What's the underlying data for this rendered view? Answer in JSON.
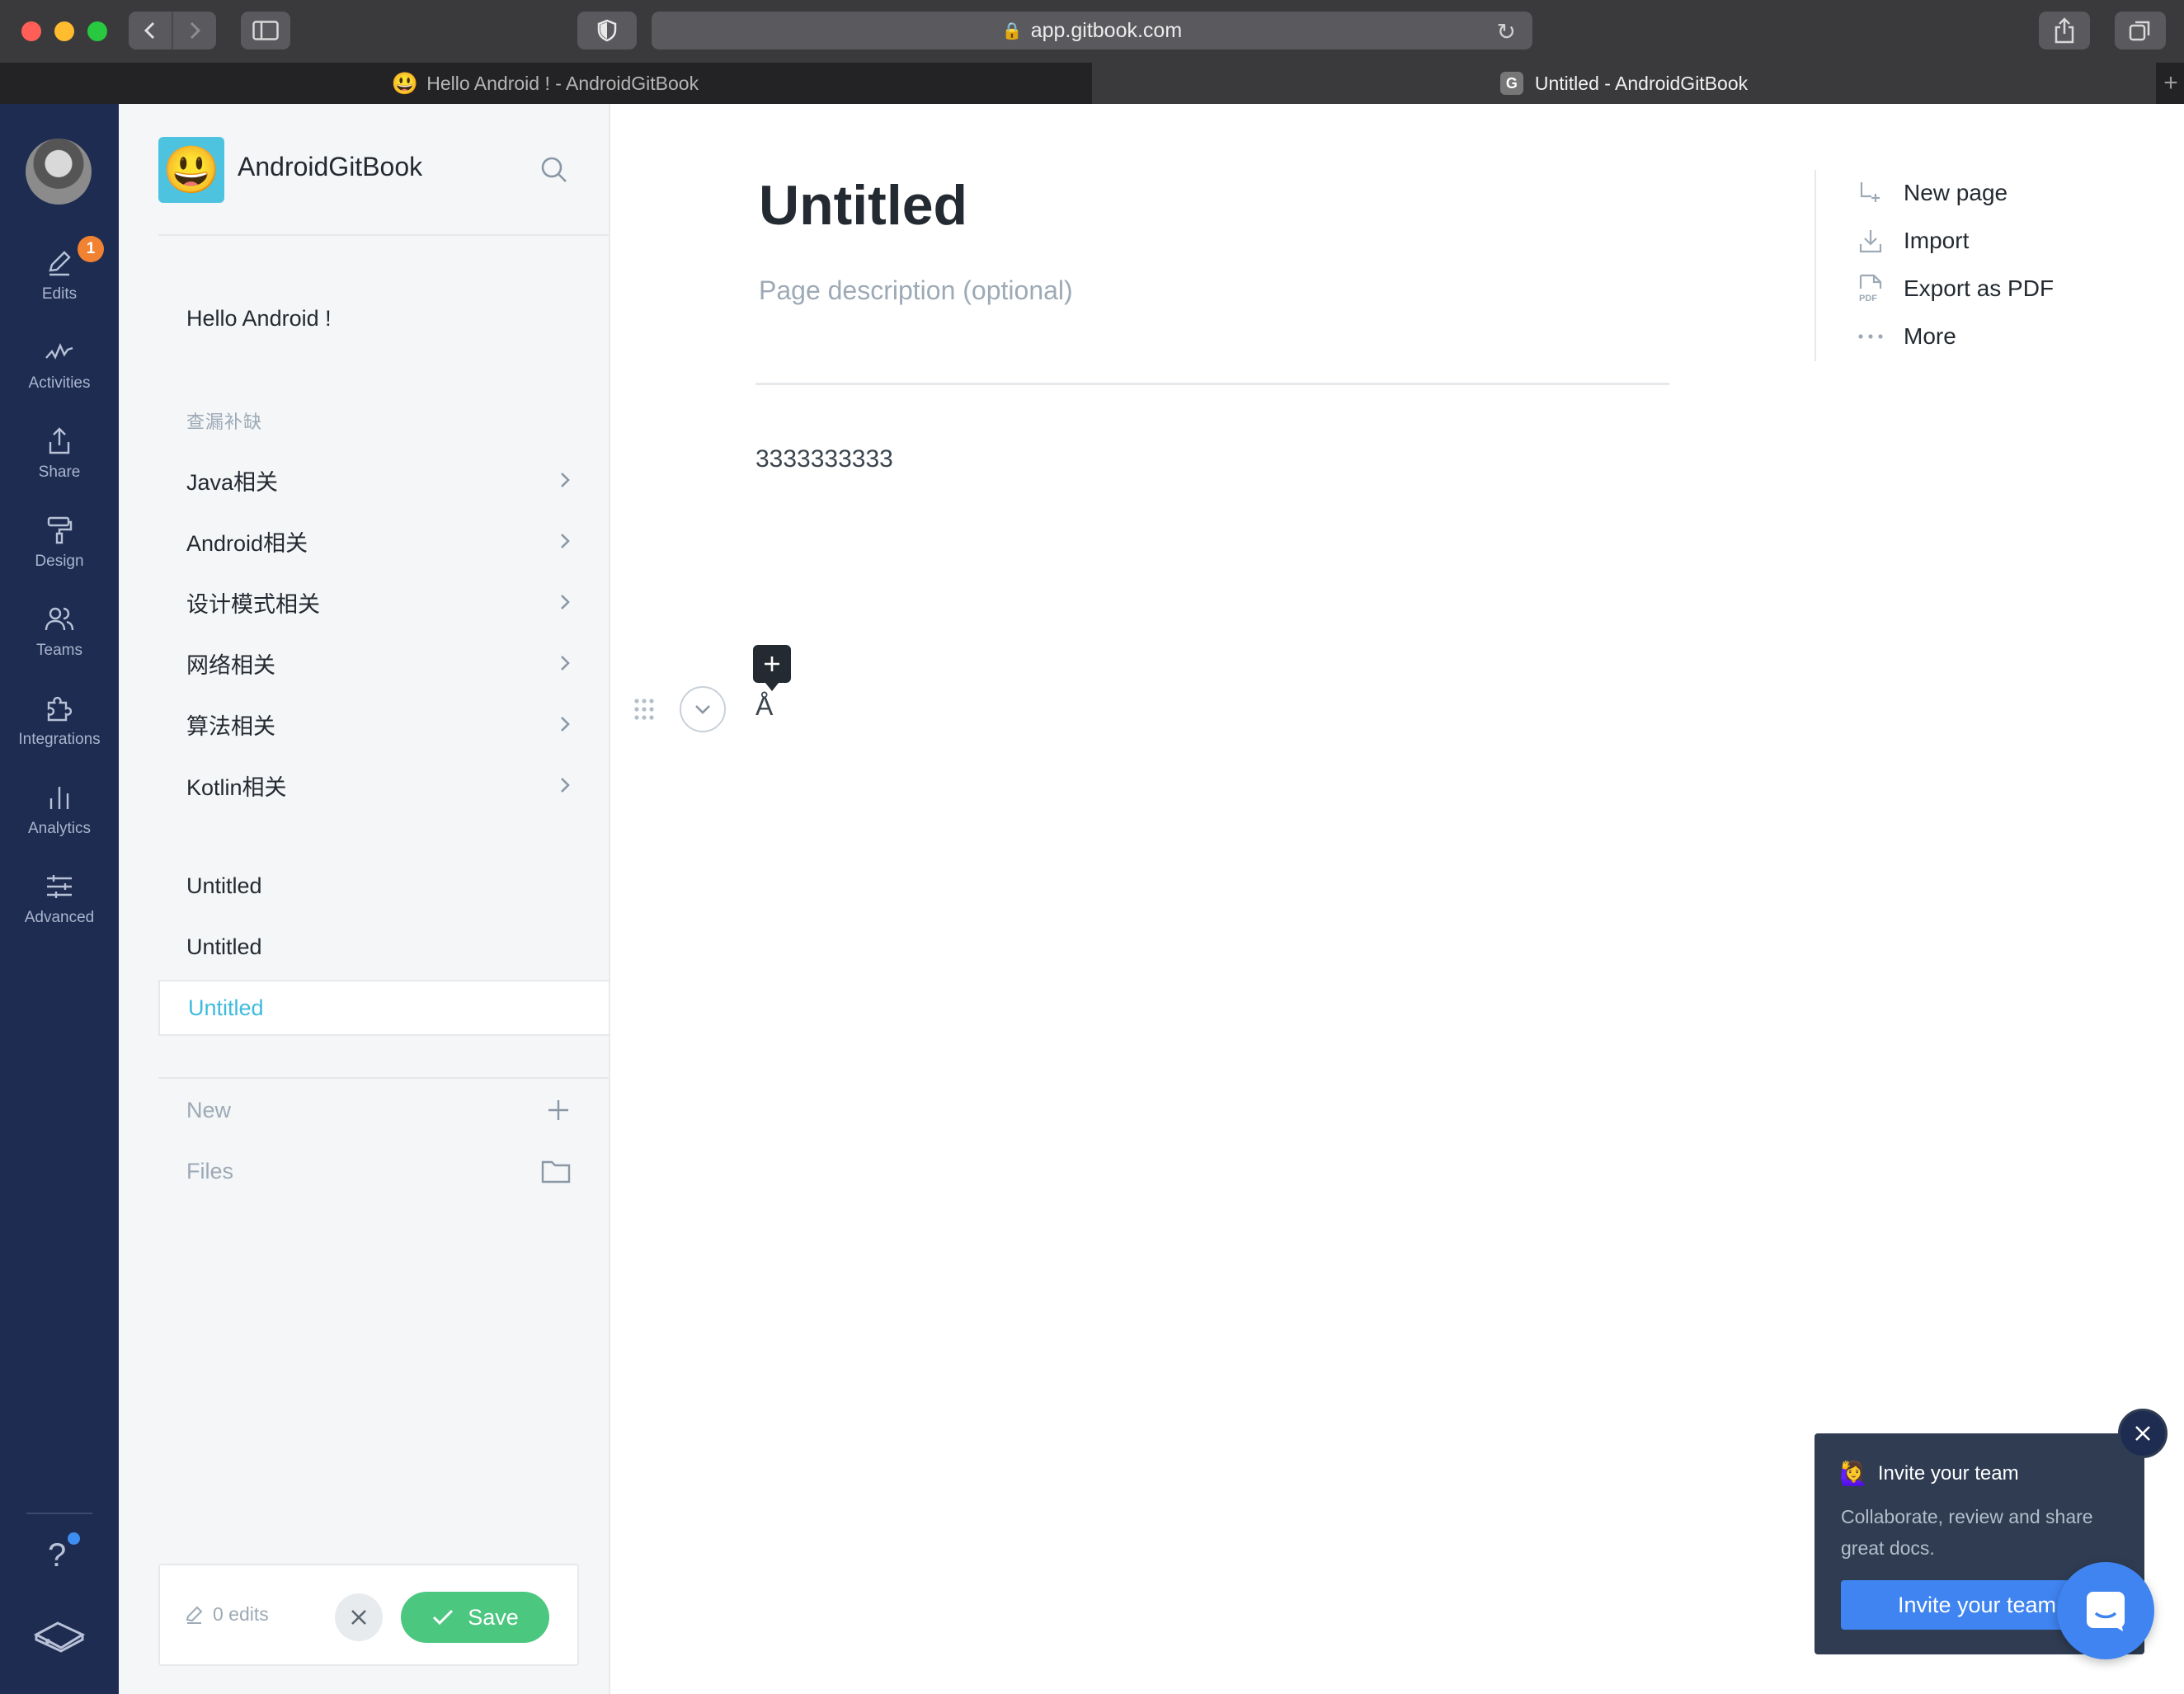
{
  "browser": {
    "url": "app.gitbook.com",
    "tabs": [
      {
        "title": "Hello Android ! - AndroidGitBook",
        "active": false
      },
      {
        "title": "Untitled - AndroidGitBook",
        "active": true
      }
    ]
  },
  "rail": {
    "edits_badge": "1",
    "items": [
      {
        "label": "Edits",
        "icon": "pencil-icon"
      },
      {
        "label": "Activities",
        "icon": "activity-icon"
      },
      {
        "label": "Share",
        "icon": "share-icon"
      },
      {
        "label": "Design",
        "icon": "paint-roller-icon"
      },
      {
        "label": "Teams",
        "icon": "users-icon"
      },
      {
        "label": "Integrations",
        "icon": "puzzle-icon"
      },
      {
        "label": "Analytics",
        "icon": "bar-chart-icon"
      },
      {
        "label": "Advanced",
        "icon": "sliders-icon"
      }
    ],
    "help_label": "?"
  },
  "space": {
    "title": "AndroidGitBook",
    "logo_emoji": "😃",
    "first_page": "Hello Android !",
    "group_label": "查漏补缺",
    "groups": [
      {
        "label": "Java相关"
      },
      {
        "label": "Android相关"
      },
      {
        "label": "设计模式相关"
      },
      {
        "label": "网络相关"
      },
      {
        "label": "算法相关"
      },
      {
        "label": "Kotlin相关"
      }
    ],
    "pages": [
      {
        "label": "Untitled",
        "active": false
      },
      {
        "label": "Untitled",
        "active": false
      },
      {
        "label": "Untitled",
        "active": true
      }
    ],
    "new_label": "New",
    "files_label": "Files"
  },
  "edits_bar": {
    "count_label": "0 edits",
    "save_label": "Save"
  },
  "editor": {
    "title": "Untitled",
    "description_placeholder": "Page description (optional)",
    "body_text": "3333333333",
    "block_char": "Å"
  },
  "actions": [
    {
      "label": "New page",
      "icon": "new-page-icon"
    },
    {
      "label": "Import",
      "icon": "import-icon"
    },
    {
      "label": "Export as PDF",
      "icon": "pdf-icon"
    },
    {
      "label": "More",
      "icon": "more-icon"
    }
  ],
  "invite": {
    "emoji": "🙋‍♀️",
    "title": "Invite your team",
    "body": "Collaborate, review and share great docs.",
    "button_label": "Invite your team"
  },
  "colors": {
    "rail_bg": "#1e2c52",
    "accent": "#3ebbdd",
    "save_green": "#4cc780",
    "badge_orange": "#f08232",
    "invite_blue": "#3f84f0"
  }
}
